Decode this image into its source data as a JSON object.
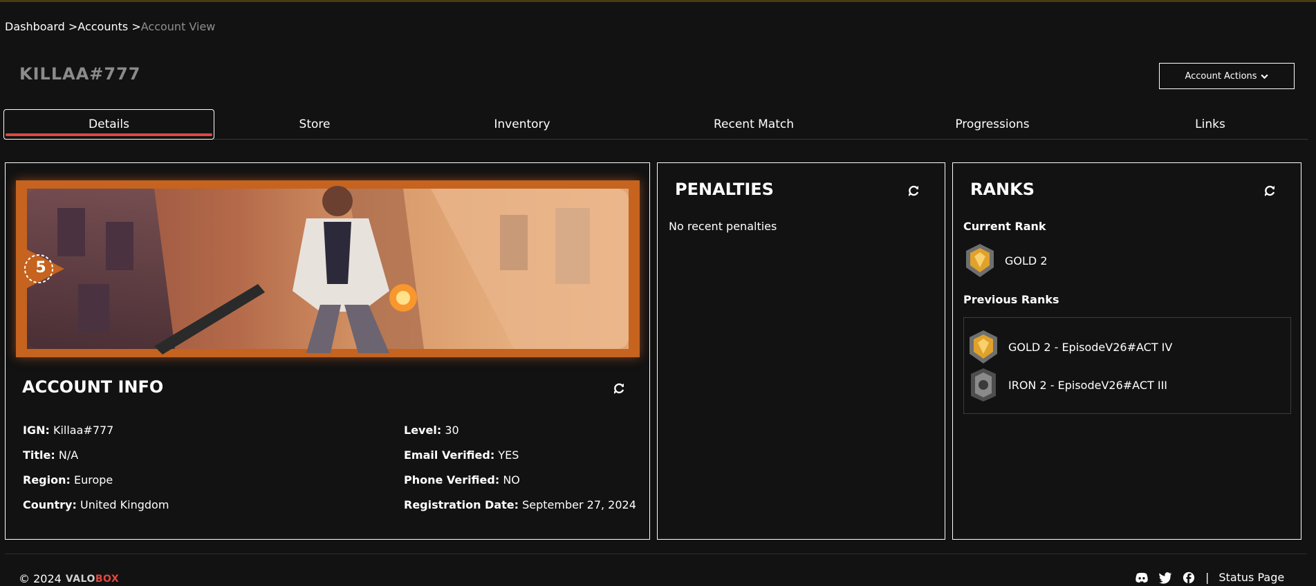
{
  "breadcrumb": {
    "items": [
      "Dashboard >",
      "Accounts >",
      "Account View"
    ]
  },
  "header": {
    "title": "KILLAA#777",
    "actions_label": "Account Actions"
  },
  "tabs": [
    {
      "label": "Details",
      "active": true
    },
    {
      "label": "Store"
    },
    {
      "label": "Inventory"
    },
    {
      "label": "Recent Match"
    },
    {
      "label": "Progressions"
    },
    {
      "label": "Links"
    }
  ],
  "account_info": {
    "heading": "ACCOUNT INFO",
    "banner_level_badge": "5",
    "left": [
      {
        "label": "IGN:",
        "value": "Killaa#777"
      },
      {
        "label": "Title:",
        "value": "N/A"
      },
      {
        "label": "Region:",
        "value": "Europe"
      },
      {
        "label": "Country:",
        "value": "United Kingdom"
      }
    ],
    "right": [
      {
        "label": "Level:",
        "value": "30"
      },
      {
        "label": "Email Verified:",
        "value": "YES"
      },
      {
        "label": "Phone Verified:",
        "value": "NO"
      },
      {
        "label": "Registration Date:",
        "value": "September 27, 2024"
      }
    ]
  },
  "penalties": {
    "heading": "PENALTIES",
    "empty_text": "No recent penalties"
  },
  "ranks": {
    "heading": "RANKS",
    "current_label": "Current Rank",
    "current": {
      "name": "GOLD 2",
      "tier": "gold"
    },
    "previous_label": "Previous Ranks",
    "previous": [
      {
        "name": "GOLD 2 - EpisodeV26#ACT IV",
        "tier": "gold"
      },
      {
        "name": "IRON 2 - EpisodeV26#ACT III",
        "tier": "iron"
      }
    ]
  },
  "footer": {
    "copyright": "© 2024",
    "logo_part1": "VALO",
    "logo_part2": "BOX",
    "status_link": "Status Page",
    "separator": "|"
  },
  "colors": {
    "background": "#121212",
    "accent_red": "#e0473f",
    "banner_orange": "#c5631f",
    "gold": "#e0a22a",
    "iron": "#6f6f6f"
  },
  "icons": [
    "chevron-down-icon",
    "refresh-icon",
    "discord-icon",
    "twitter-icon",
    "facebook-icon",
    "gold-rank-icon",
    "iron-rank-icon"
  ]
}
